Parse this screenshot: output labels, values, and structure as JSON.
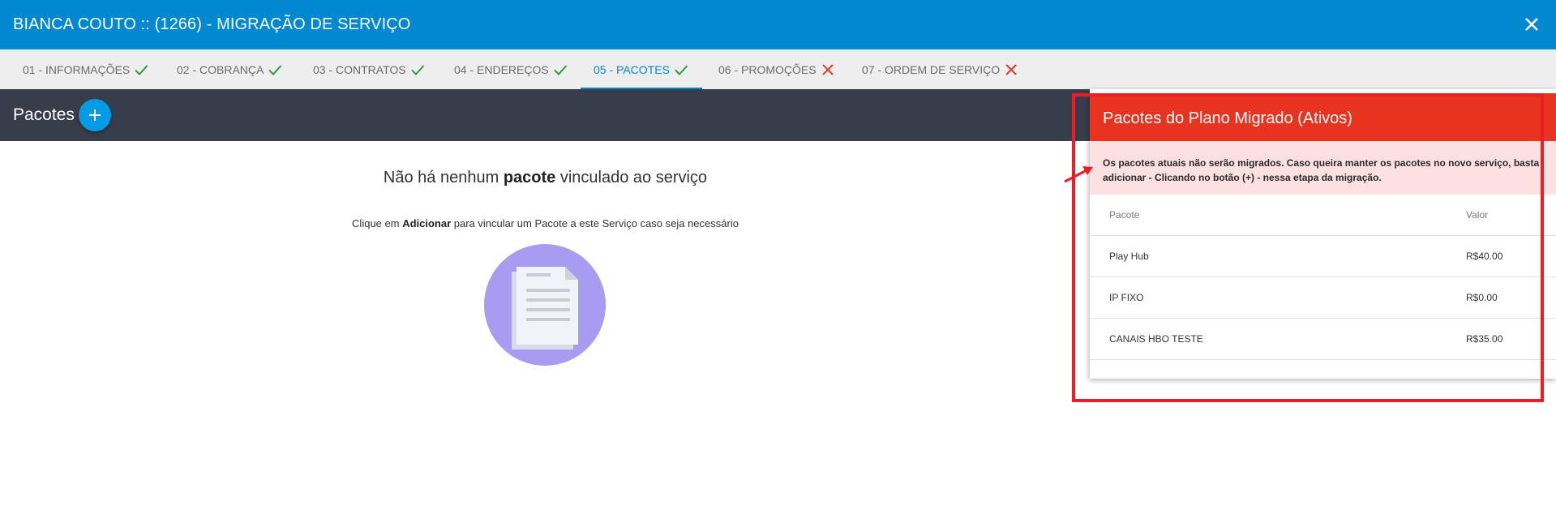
{
  "window": {
    "title": "BIANCA COUTO :: (1266) - MIGRAÇÃO DE SERVIÇO",
    "close_icon": "close-icon"
  },
  "tabs": [
    {
      "label": "01 - INFORMAÇÕES",
      "status": "done"
    },
    {
      "label": "02 - COBRANÇA",
      "status": "done"
    },
    {
      "label": "03 - CONTRATOS",
      "status": "done"
    },
    {
      "label": "04 - ENDEREÇOS",
      "status": "done"
    },
    {
      "label": "05 - PACOTES",
      "status": "done",
      "active": true
    },
    {
      "label": "06 - PROMOÇÕES",
      "status": "error"
    },
    {
      "label": "07 - ORDEM DE SERVIÇO",
      "status": "error"
    }
  ],
  "section": {
    "label": "Pacotes",
    "add_icon": "plus-icon"
  },
  "empty_state": {
    "title_pre": "Não há nenhum ",
    "title_bold": "pacote",
    "title_post": " vinculado ao serviço",
    "sub_pre": "Clique em ",
    "sub_bold": "Adicionar",
    "sub_post": " para vincular um Pacote a este Serviço caso seja necessário",
    "icon": "document-icon"
  },
  "panel": {
    "title": "Pacotes do Plano Migrado (Ativos)",
    "warning": "Os pacotes atuais não serão migrados. Caso queira manter os pacotes no novo serviço, basta adicionar - Clicando no botão (+) - nessa etapa da migração.",
    "columns": [
      "Pacote",
      "Valor"
    ],
    "rows": [
      {
        "pacote": "Play Hub",
        "valor": "R$40.00"
      },
      {
        "pacote": "IP FIXO",
        "valor": "R$0.00"
      },
      {
        "pacote": "CANAIS HBO TESTE",
        "valor": "R$35.00"
      }
    ]
  },
  "colors": {
    "titlebar": "#0288d1",
    "darkbar": "#373d4a",
    "panel_header": "#e8331f",
    "warning_bg": "#fde0e0",
    "check": "#2e9b3e",
    "error_x": "#e53935",
    "highlight": "#ee1c24"
  }
}
